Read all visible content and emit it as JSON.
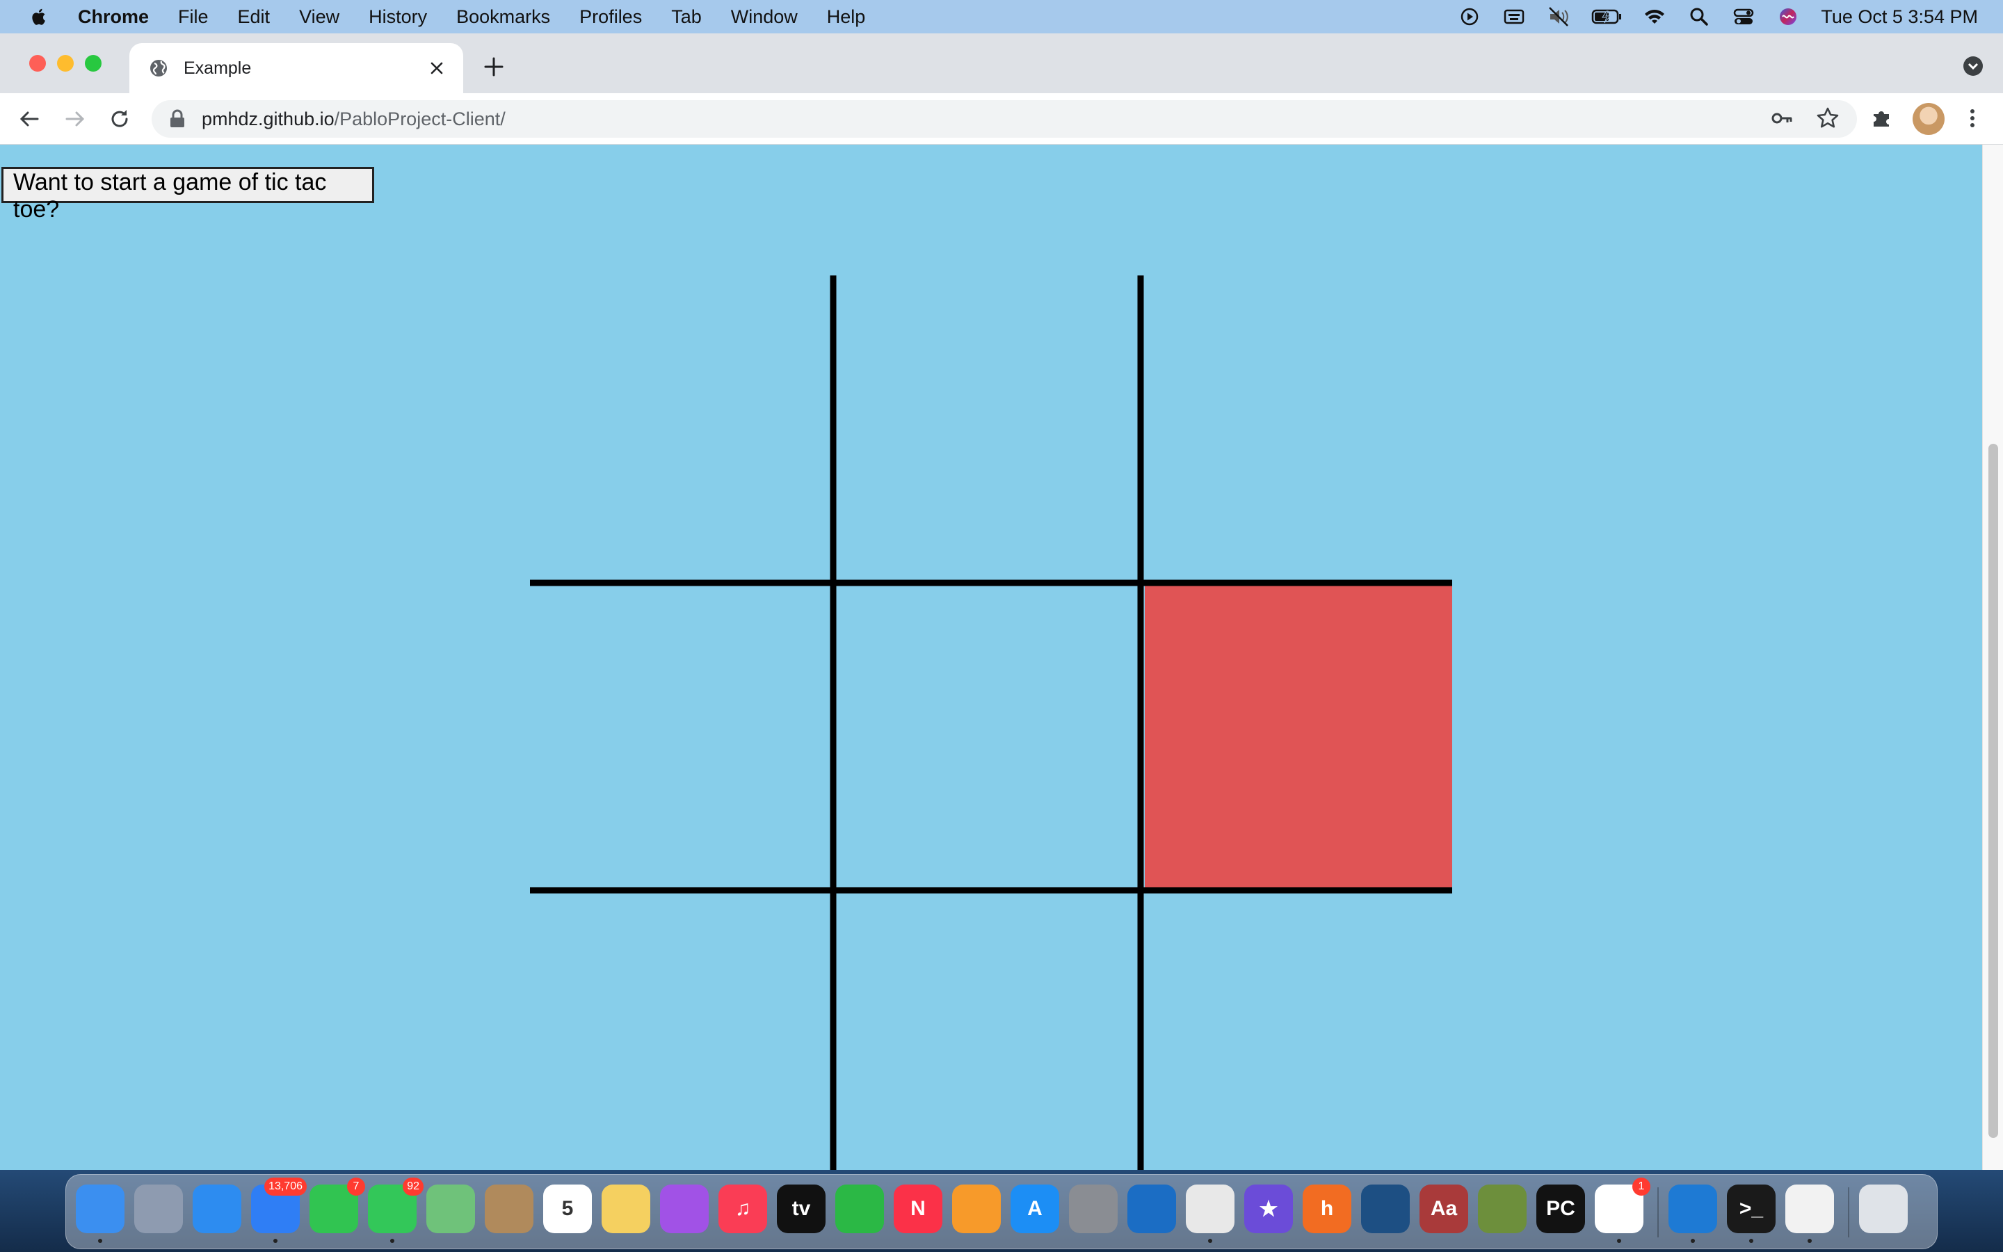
{
  "menubar": {
    "app_name": "Chrome",
    "items": [
      "File",
      "Edit",
      "View",
      "History",
      "Bookmarks",
      "Profiles",
      "Tab",
      "Window",
      "Help"
    ],
    "clock": "Tue Oct 5  3:54 PM",
    "status_icons": [
      "screen-recording-icon",
      "keyboard-input-icon",
      "muted-icon",
      "battery-icon",
      "wifi-icon",
      "spotlight-search-icon",
      "control-center-icon",
      "siri-icon"
    ]
  },
  "browser": {
    "tab_title": "Example",
    "url_host": "pmhdz.github.io",
    "url_path": "/PabloProject-Client/"
  },
  "page": {
    "start_button_label": "Want to start a game of tic tac toe?",
    "background_color": "#87ceea",
    "board": {
      "line_color": "#000000",
      "cells": [
        [
          "",
          "",
          ""
        ],
        [
          "",
          "",
          "red"
        ],
        [
          "",
          "",
          ""
        ]
      ],
      "marked_cell_color": "#e05455"
    }
  },
  "dock": {
    "apps": [
      {
        "name": "finder",
        "label": "",
        "color": "#3b8ff0"
      },
      {
        "name": "launchpad",
        "label": "",
        "color": "#8e9bb0"
      },
      {
        "name": "safari",
        "label": "",
        "color": "#2d8cf0"
      },
      {
        "name": "mail",
        "label": "",
        "color": "#2f7ef5",
        "badge": "13,706"
      },
      {
        "name": "facetime",
        "label": "",
        "color": "#31c451",
        "badge": "7"
      },
      {
        "name": "messages",
        "label": "",
        "color": "#33c759",
        "badge": "92"
      },
      {
        "name": "maps",
        "label": "",
        "color": "#6fc27a"
      },
      {
        "name": "contacts",
        "label": "",
        "color": "#b08a5c"
      },
      {
        "name": "calendar",
        "label": "5",
        "color": "#ffffff"
      },
      {
        "name": "notes",
        "label": "",
        "color": "#f5d060"
      },
      {
        "name": "podcasts",
        "label": "",
        "color": "#a152e6"
      },
      {
        "name": "music",
        "label": "♫",
        "color": "#fa3d55"
      },
      {
        "name": "apple-tv",
        "label": "tv",
        "color": "#111111"
      },
      {
        "name": "numbers",
        "label": "",
        "color": "#2bb845"
      },
      {
        "name": "news",
        "label": "N",
        "color": "#fb3148"
      },
      {
        "name": "pages",
        "label": "",
        "color": "#f79a2a"
      },
      {
        "name": "app-store",
        "label": "A",
        "color": "#1c8ef5"
      },
      {
        "name": "system-preferences",
        "label": "",
        "color": "#8a8d93"
      },
      {
        "name": "vscode-insiders",
        "label": "",
        "color": "#1b6dc4"
      },
      {
        "name": "chrome",
        "label": "",
        "color": "#e8e8e8"
      },
      {
        "name": "imovie",
        "label": "★",
        "color": "#6b4cd8"
      },
      {
        "name": "honey",
        "label": "h",
        "color": "#f26c22"
      },
      {
        "name": "quicktime",
        "label": "",
        "color": "#1d4f83"
      },
      {
        "name": "dictionary",
        "label": "Aa",
        "color": "#a93a3a"
      },
      {
        "name": "minecraft",
        "label": "",
        "color": "#6d8f3c"
      },
      {
        "name": "pycharm",
        "label": "PC",
        "color": "#121212"
      },
      {
        "name": "slack",
        "label": "",
        "color": "#ffffff",
        "badge": "1"
      },
      {
        "name": "vscode",
        "label": "",
        "color": "#1e7ad4"
      },
      {
        "name": "terminal",
        "label": ">_",
        "color": "#1a1a1a"
      },
      {
        "name": "photos",
        "label": "",
        "color": "#f2f2f2"
      },
      {
        "name": "trash",
        "label": "",
        "color": "#dfe3e8"
      }
    ]
  }
}
